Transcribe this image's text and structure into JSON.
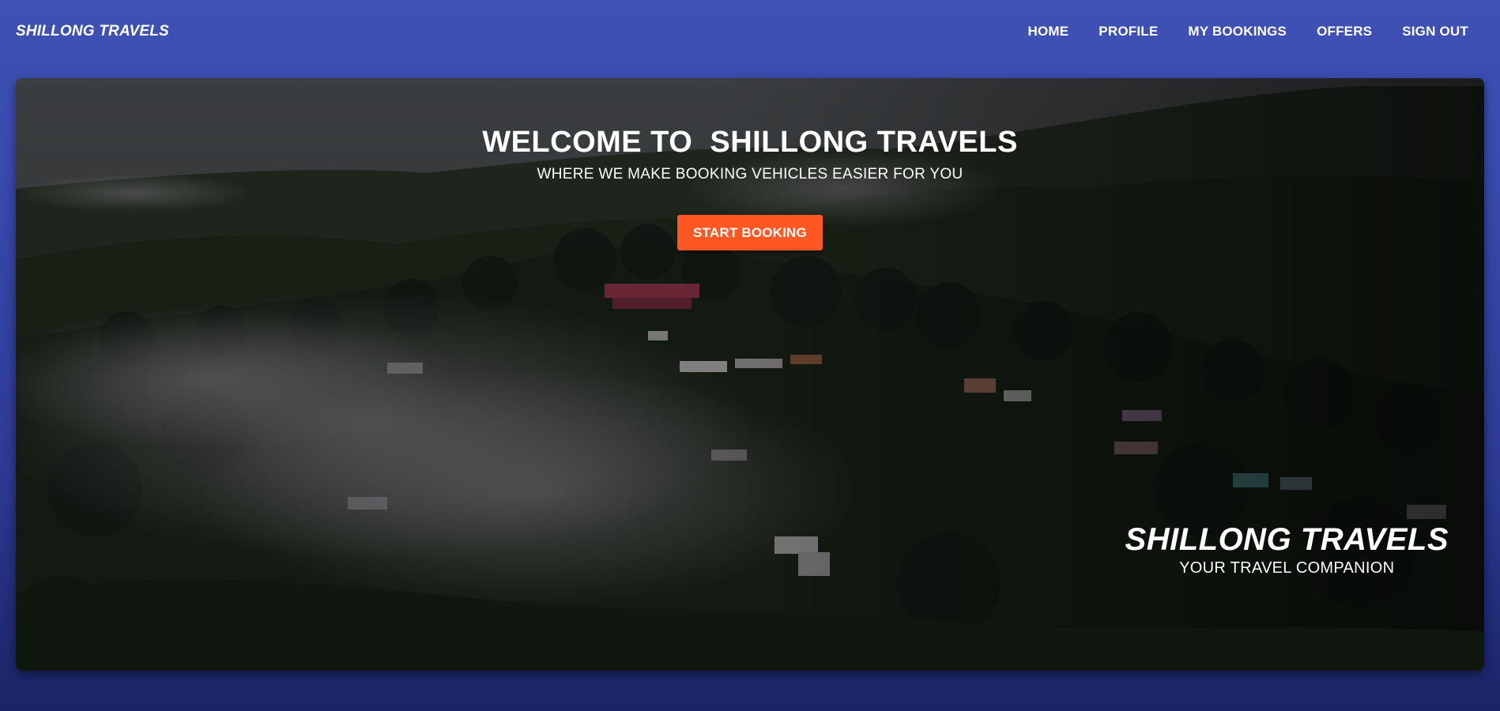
{
  "navbar": {
    "brand": "SHILLONG TRAVELS",
    "links": [
      "HOME",
      "PROFILE",
      "MY BOOKINGS",
      "OFFERS",
      "SIGN OUT"
    ]
  },
  "hero": {
    "title": "WELCOME TO  SHILLONG TRAVELS",
    "subtitle": "WHERE WE MAKE BOOKING VEHICLES EASIER FOR YOU",
    "cta_label": "START BOOKING",
    "corner_title": "SHILLONG TRAVELS",
    "corner_subtitle": "YOUR TRAVEL COMPANION",
    "background_image": "misty-forest-hillside-with-houses"
  },
  "colors": {
    "primary": "#3f51b5",
    "accent": "#ff5722",
    "text": "#ffffff"
  }
}
